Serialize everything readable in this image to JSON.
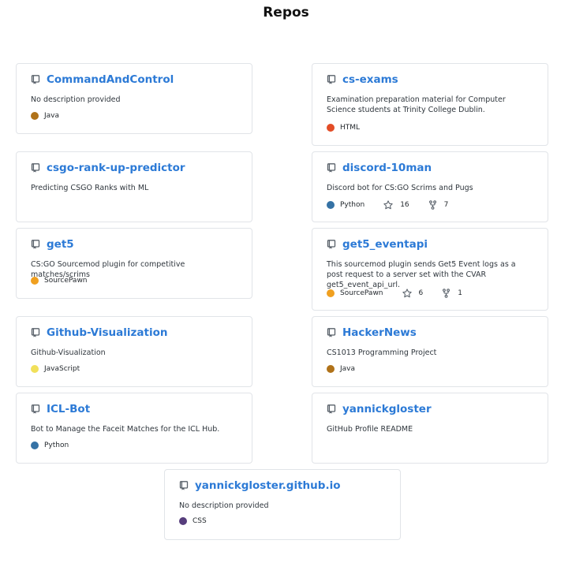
{
  "page": {
    "title": "Repos"
  },
  "colors": {
    "link": "#2c7ad6",
    "Java": "#b07219",
    "HTML": "#e34c26",
    "Python": "#3572A5",
    "SourcePawn": "#f0a020",
    "JavaScript": "#f1e05a",
    "CSS": "#563d7c"
  },
  "repos": [
    {
      "name": "CommandAndControl",
      "description": "No description provided",
      "language": "Java",
      "lang_color": "#b07219"
    },
    {
      "name": "cs-exams",
      "description": "Examination preparation material for Computer Science students at Trinity College Dublin.",
      "language": "HTML",
      "lang_color": "#e34c26"
    },
    {
      "name": "csgo-rank-up-predictor",
      "description": "Predicting CSGO Ranks with ML"
    },
    {
      "name": "discord-10man",
      "description": "Discord bot for CS:GO Scrims and Pugs",
      "language": "Python",
      "lang_color": "#3572A5",
      "stars": "16",
      "forks": "7"
    },
    {
      "name": "get5",
      "description": "CS:GO Sourcemod plugin for competitive matches/scrims",
      "language": "SourcePawn",
      "lang_color": "#f0a020"
    },
    {
      "name": "get5_eventapi",
      "description": "This sourcemod plugin sends Get5 Event logs as a post request to a server set with the CVAR get5_event_api_url.",
      "language": "SourcePawn",
      "lang_color": "#f0a020",
      "stars": "6",
      "forks": "1"
    },
    {
      "name": "Github-Visualization",
      "description": "Github-Visualization",
      "language": "JavaScript",
      "lang_color": "#f1e05a"
    },
    {
      "name": "HackerNews",
      "description": "CS1013 Programming Project",
      "language": "Java",
      "lang_color": "#b07219"
    },
    {
      "name": "ICL-Bot",
      "description": "Bot to Manage the Faceit Matches for the ICL Hub.",
      "language": "Python",
      "lang_color": "#3572A5"
    },
    {
      "name": "yannickgloster",
      "description": "GitHub Profile README"
    },
    {
      "name": "yannickgloster.github.io",
      "description": "No description provided",
      "language": "CSS",
      "lang_color": "#563d7c"
    }
  ]
}
